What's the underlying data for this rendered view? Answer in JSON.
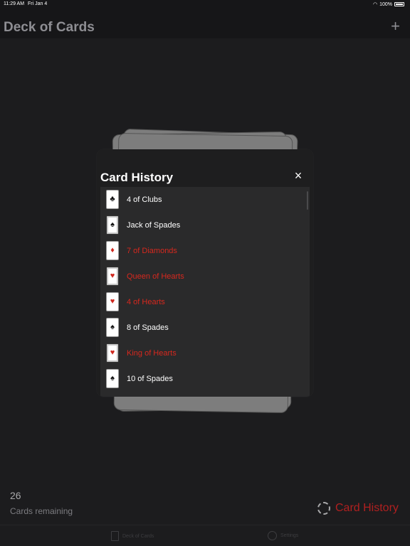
{
  "status_bar": {
    "time": "11:29 AM",
    "date": "Fri Jan 4",
    "battery": "100%"
  },
  "nav": {
    "title": "Deck of Cards",
    "add_label": "+"
  },
  "modal": {
    "title": "Card History",
    "close_label": "×",
    "items": [
      {
        "label": "4 of Clubs",
        "color": "black",
        "suit": "♣",
        "face": false
      },
      {
        "label": "Jack of Spades",
        "color": "black",
        "suit": "♠",
        "face": true
      },
      {
        "label": "7 of Diamonds",
        "color": "red",
        "suit": "♦",
        "face": false
      },
      {
        "label": "Queen of Hearts",
        "color": "red",
        "suit": "♥",
        "face": true
      },
      {
        "label": "4 of Hearts",
        "color": "red",
        "suit": "♥",
        "face": false
      },
      {
        "label": "8 of Spades",
        "color": "black",
        "suit": "♠",
        "face": false
      },
      {
        "label": "King of Hearts",
        "color": "red",
        "suit": "♥",
        "face": true
      },
      {
        "label": "10 of Spades",
        "color": "black",
        "suit": "♠",
        "face": false
      }
    ]
  },
  "footer": {
    "count": "26",
    "remaining_label": "Cards remaining",
    "history_button_label": "Card History"
  },
  "tabs": [
    {
      "label": "Deck of Cards",
      "icon": "deck-icon"
    },
    {
      "label": "Settings",
      "icon": "gear-icon"
    }
  ],
  "colors": {
    "accent_red": "#d7281e",
    "background": "#1c1c1e"
  }
}
